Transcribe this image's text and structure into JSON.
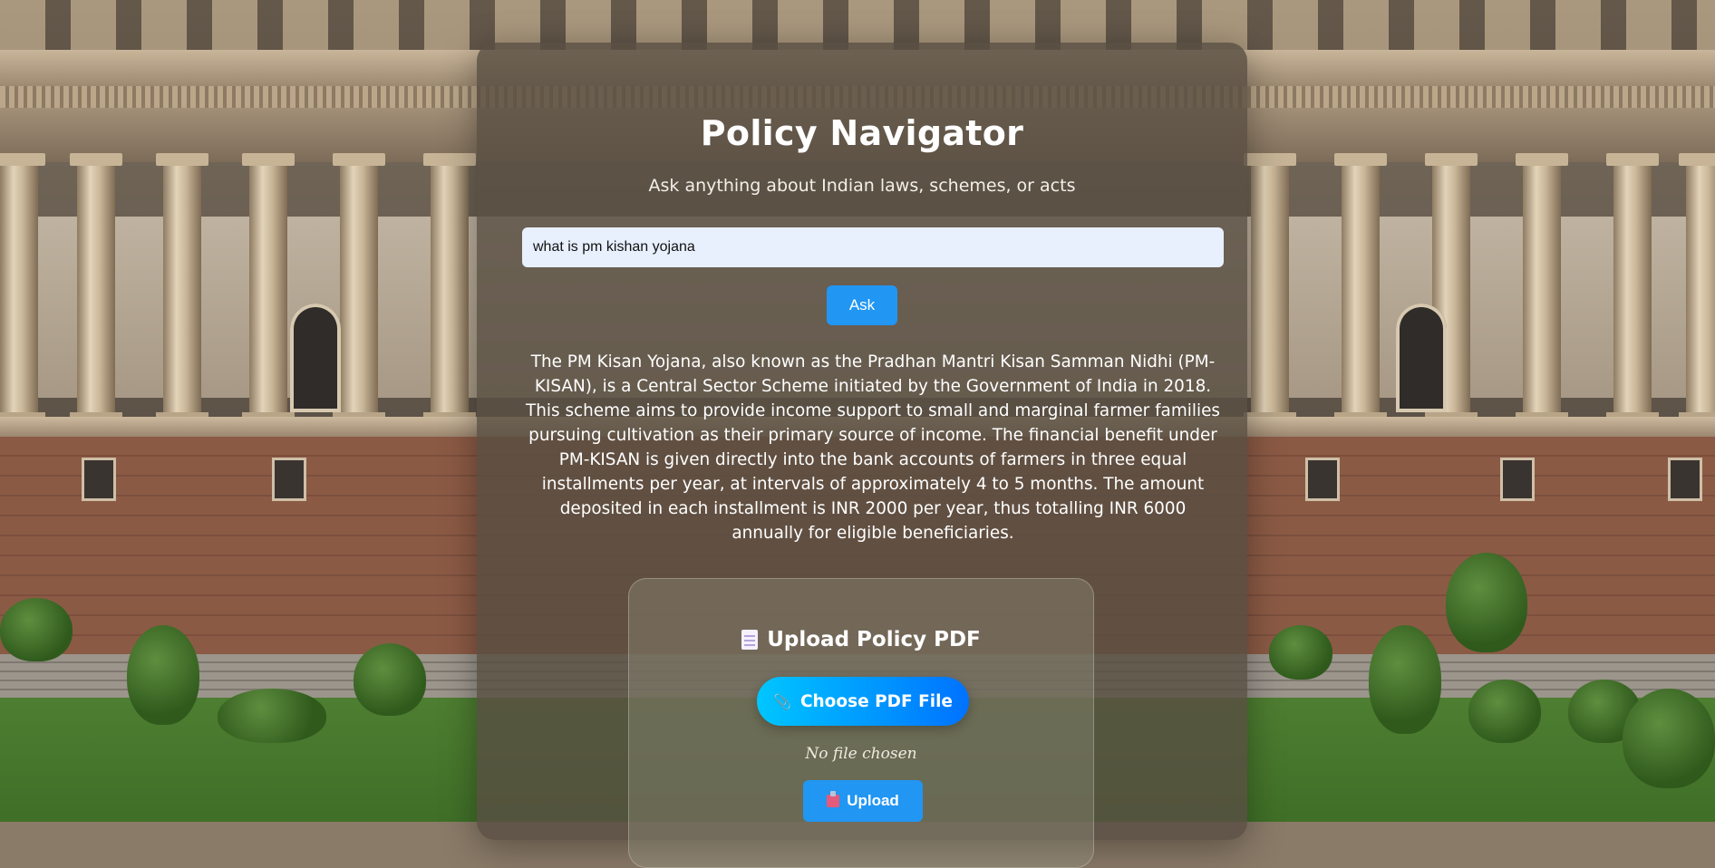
{
  "app": {
    "title": "Policy Navigator",
    "subtitle": "Ask anything about Indian laws, schemes, or acts"
  },
  "query": {
    "value": "what is pm kishan yojana"
  },
  "ask_button": {
    "label": "Ask"
  },
  "answer": {
    "text": "The PM Kisan Yojana, also known as the Pradhan Mantri Kisan Samman Nidhi (PM-KISAN), is a Central Sector Scheme initiated by the Government of India in 2018. This scheme aims to provide income support to small and marginal farmer families pursuing cultivation as their primary source of income. The financial benefit under PM-KISAN is given directly into the bank accounts of farmers in three equal installments per year, at intervals of approximately 4 to 5 months. The amount deposited in each installment is INR 2000 per year, thus totalling INR 6000 annually for eligible beneficiaries."
  },
  "upload": {
    "title": "Upload Policy PDF",
    "title_icon": "document-icon",
    "choose_label": "Choose PDF File",
    "choose_icon": "paperclip-icon",
    "file_status": "No file chosen",
    "upload_label": "Upload",
    "upload_icon": "inbox-tray-icon"
  },
  "colors": {
    "accent": "#2196f3",
    "choose_gradient_start": "#00c6ff",
    "choose_gradient_end": "#0072ff",
    "input_bg": "#e8f0fe"
  }
}
